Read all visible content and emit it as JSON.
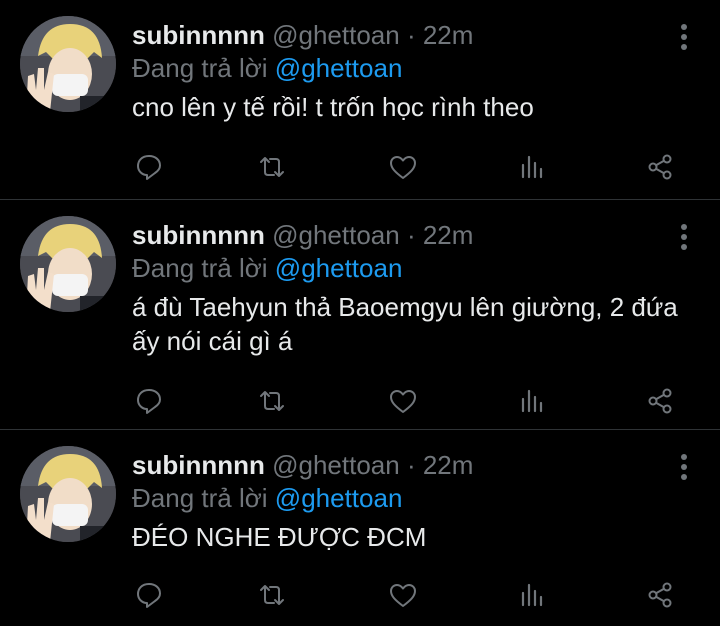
{
  "tweets": [
    {
      "display_name": "subinnnnn",
      "handle": "@ghettoan",
      "time": "· 22m",
      "reply_prefix": "Đang trả lời",
      "reply_to": "@ghettoan",
      "text": "cno lên y tế rồi! t trốn học rình theo"
    },
    {
      "display_name": "subinnnnn",
      "handle": "@ghettoan",
      "time": "· 22m",
      "reply_prefix": "Đang trả lời",
      "reply_to": "@ghettoan",
      "text": "á đù Taehyun thả Baoemgyu lên giường, 2 đứa ấy nói cái gì á"
    },
    {
      "display_name": "subinnnnn",
      "handle": "@ghettoan",
      "time": "· 22m",
      "reply_prefix": "Đang trả lời",
      "reply_to": "@ghettoan",
      "text": "ĐÉO NGHE ĐƯỢC ĐCM"
    }
  ],
  "icons": {
    "reply": "reply-icon",
    "retweet": "retweet-icon",
    "like": "heart-icon",
    "views": "views-icon",
    "share": "share-icon",
    "more": "more-vertical-icon"
  },
  "colors": {
    "background": "#000000",
    "text": "#e7e9ea",
    "muted": "#71767b",
    "accent": "#1d9bf0",
    "divider": "#2f3336"
  }
}
